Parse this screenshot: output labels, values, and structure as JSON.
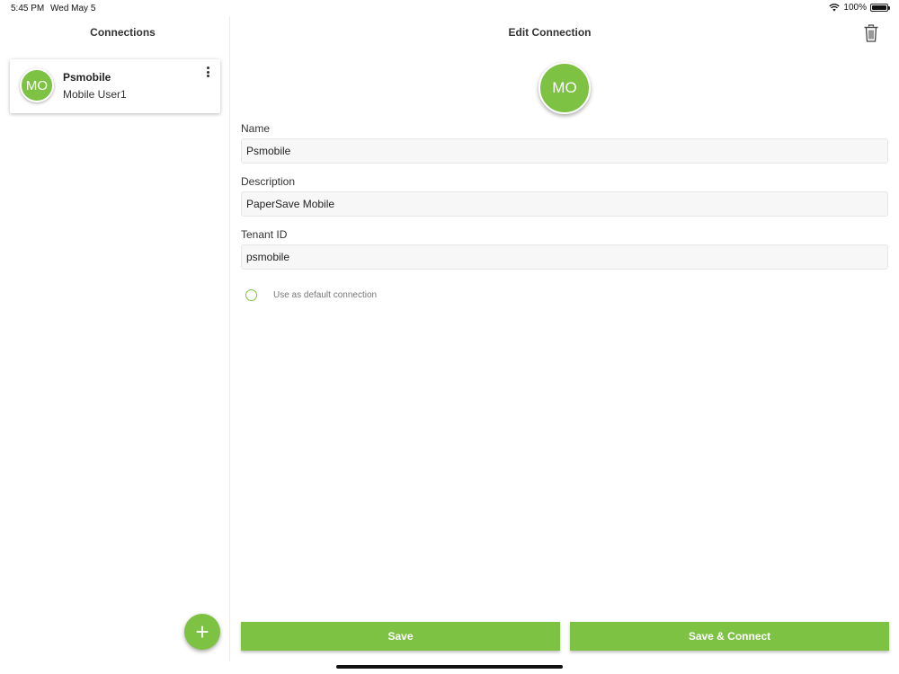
{
  "status_bar": {
    "time": "5:45 PM",
    "date": "Wed May 5",
    "battery": "100%"
  },
  "left": {
    "title": "Connections",
    "connections": [
      {
        "initials": "MO",
        "name": "Psmobile",
        "user": "Mobile User1"
      }
    ],
    "fab_label": "+"
  },
  "right": {
    "title": "Edit Connection",
    "avatar_initials": "MO",
    "fields": {
      "name": {
        "label": "Name",
        "value": "Psmobile"
      },
      "description": {
        "label": "Description",
        "value": "PaperSave Mobile"
      },
      "tenant": {
        "label": "Tenant ID",
        "value": "psmobile"
      }
    },
    "default_option": {
      "label": "Use as default connection",
      "checked": false
    },
    "buttons": {
      "save": "Save",
      "save_connect": "Save & Connect"
    }
  },
  "colors": {
    "accent": "#7dc242"
  },
  "icons": [
    "wifi-icon",
    "battery-icon",
    "more-vertical-icon",
    "trash-icon",
    "plus-icon"
  ]
}
